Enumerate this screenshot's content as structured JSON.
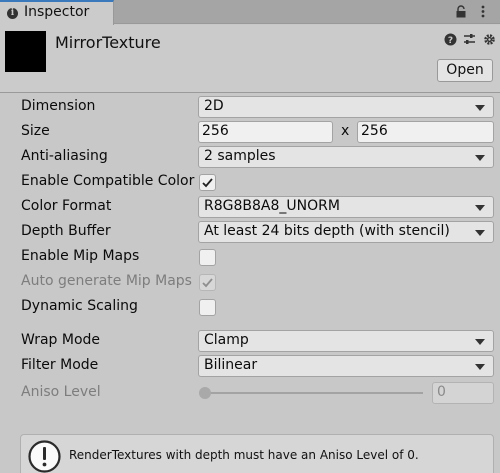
{
  "tab": {
    "label": "Inspector",
    "icon": "info-icon"
  },
  "header": {
    "object_name": "MirrorTexture",
    "open_label": "Open"
  },
  "fields": {
    "dimension": {
      "label": "Dimension",
      "value": "2D"
    },
    "size": {
      "label": "Size",
      "width": "256",
      "separator": "x",
      "height": "256"
    },
    "anti_aliasing": {
      "label": "Anti-aliasing",
      "value": "2 samples"
    },
    "enable_compatible_color": {
      "label": "Enable Compatible Color Format",
      "checked": true
    },
    "color_format": {
      "label": "Color Format",
      "value": "R8G8B8A8_UNORM"
    },
    "depth_buffer": {
      "label": "Depth Buffer",
      "value": "At least 24 bits depth (with stencil)"
    },
    "enable_mip_maps": {
      "label": "Enable Mip Maps",
      "checked": false
    },
    "auto_generate_mip_maps": {
      "label": "Auto generate Mip Maps",
      "checked": true,
      "disabled": true
    },
    "dynamic_scaling": {
      "label": "Dynamic Scaling",
      "checked": false
    },
    "wrap_mode": {
      "label": "Wrap Mode",
      "value": "Clamp"
    },
    "filter_mode": {
      "label": "Filter Mode",
      "value": "Bilinear"
    },
    "aniso_level": {
      "label": "Aniso Level",
      "value": "0",
      "disabled": true
    }
  },
  "help_message": "RenderTextures with depth must have an Aniso Level of 0."
}
